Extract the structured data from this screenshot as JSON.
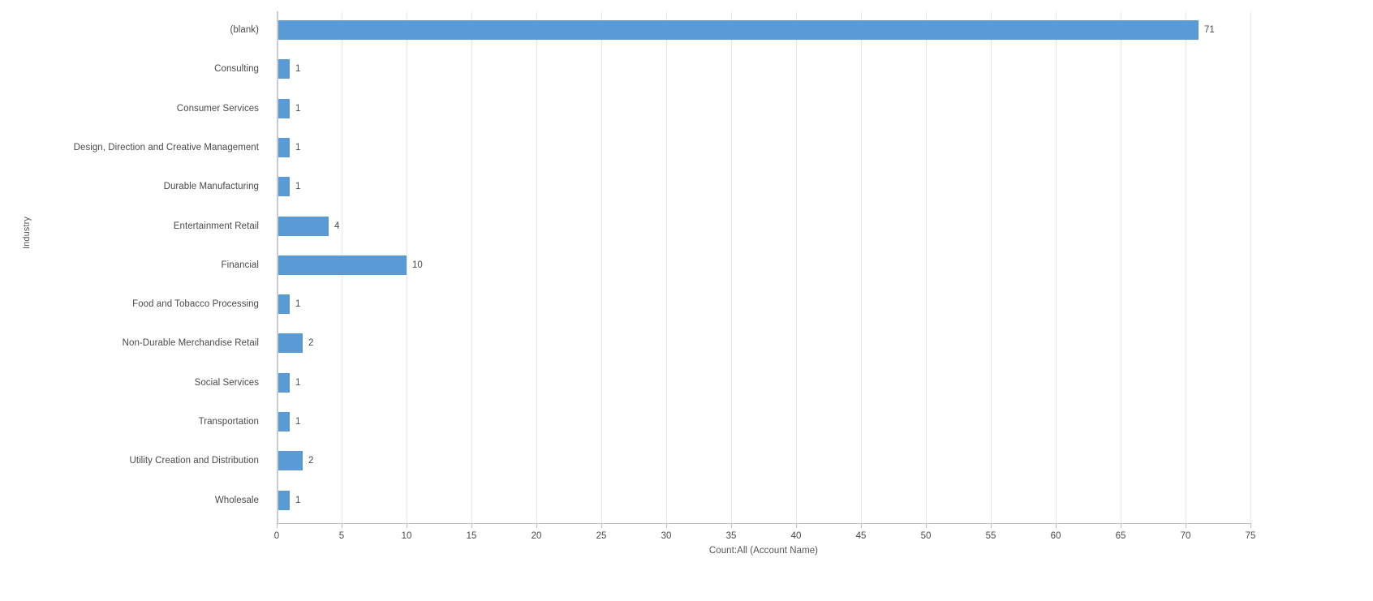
{
  "chart_data": {
    "type": "bar",
    "orientation": "horizontal",
    "title": "",
    "xlabel": "Count:All (Account Name)",
    "ylabel": "Industry",
    "categories": [
      "(blank)",
      "Consulting",
      "Consumer Services",
      "Design, Direction and Creative Management",
      "Durable Manufacturing",
      "Entertainment Retail",
      "Financial",
      "Food and Tobacco Processing",
      "Non-Durable Merchandise Retail",
      "Social Services",
      "Transportation",
      "Utility Creation and Distribution",
      "Wholesale"
    ],
    "values": [
      71,
      1,
      1,
      1,
      1,
      4,
      10,
      1,
      2,
      1,
      1,
      2,
      1
    ],
    "data_labels": [
      "71",
      "1",
      "1",
      "1",
      "1",
      "4",
      "10",
      "1",
      "2",
      "1",
      "1",
      "2",
      "1"
    ],
    "xlim": [
      0,
      75
    ],
    "x_ticks": [
      0,
      5,
      10,
      15,
      20,
      25,
      30,
      35,
      40,
      45,
      50,
      55,
      60,
      65,
      70,
      75
    ],
    "x_tick_labels": [
      "0",
      "5",
      "10",
      "15",
      "20",
      "25",
      "30",
      "35",
      "40",
      "45",
      "50",
      "55",
      "60",
      "65",
      "70",
      "75"
    ],
    "grid": true,
    "grid_axis": "x",
    "legend": false,
    "bar_color": "#5B9BD5",
    "gridline_color": "#EAEAEA",
    "axis_line_color": "#C8CCD4",
    "text_color": "#4A4A4A",
    "background_color": "#FFFFFF"
  }
}
